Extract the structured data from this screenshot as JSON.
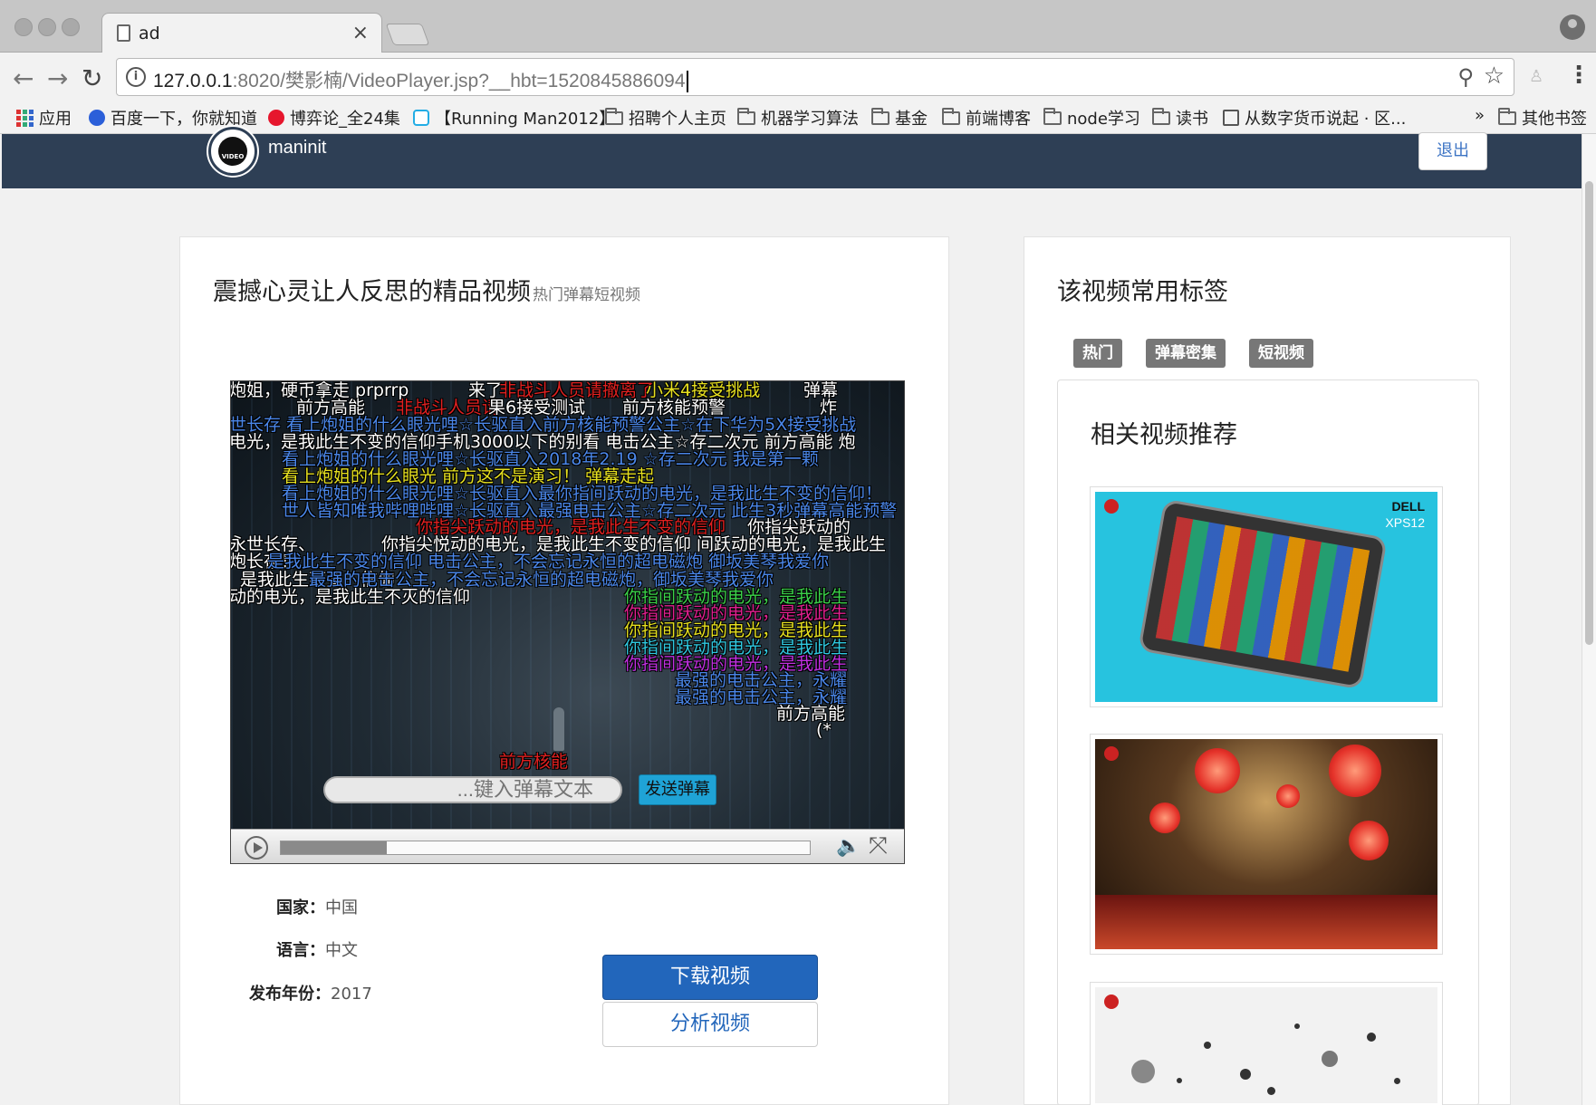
{
  "browser": {
    "tab_title": "ad",
    "tab_close": "×",
    "url_host": "127.0.0.1",
    "url_rest": ":8020/樊影楠/VideoPlayer.jsp?__hbt=1520845886094",
    "bookmarks": [
      {
        "label": "应用",
        "icon": "apps-grid-icon"
      },
      {
        "label": "百度一下，你就知道",
        "icon": "baidu-paw-icon"
      },
      {
        "label": "博弈论_全24集",
        "icon": "weibo-icon"
      },
      {
        "label": "【Running Man2012】",
        "icon": "bilibili-tv-icon"
      },
      {
        "label": "招聘个人主页",
        "icon": "folder-icon"
      },
      {
        "label": "机器学习算法",
        "icon": "folder-icon"
      },
      {
        "label": "基金",
        "icon": "folder-icon"
      },
      {
        "label": "前端博客",
        "icon": "folder-icon"
      },
      {
        "label": "node学习",
        "icon": "folder-icon"
      },
      {
        "label": "读书",
        "icon": "folder-icon"
      },
      {
        "label": "从数字货币说起 · 区...",
        "icon": "book-icon"
      }
    ],
    "bookmarks_overflow": "»",
    "other_bookmarks": "其他书签"
  },
  "site": {
    "logo_text": "VIDEO",
    "username": "maninit",
    "logout_label": "退出"
  },
  "video": {
    "title": "震撼心灵让人反思的精品视频",
    "subtitle": "热门弹幕短视频",
    "progress_percent": 20,
    "danmaku_placeholder": "...键入弹幕文本",
    "send_label": "发送弹幕",
    "danmaku": [
      {
        "text": "炮姐，硬币拿走 prprrp",
        "color": "#ffffff"
      },
      {
        "text": "来了",
        "color": "#ffffff"
      },
      {
        "text": "非战斗人员请撤离了",
        "color": "#e02020"
      },
      {
        "text": "小米4接受挑战",
        "color": "#e6e020"
      },
      {
        "text": "弹幕",
        "color": "#ffffff"
      },
      {
        "text": "前方高能",
        "color": "#ffffff"
      },
      {
        "text": "非战斗人员请",
        "color": "#e02020"
      },
      {
        "text": "果6接受测试",
        "color": "#ffffff"
      },
      {
        "text": "前方核能预警",
        "color": "#ffffff"
      },
      {
        "text": "炸",
        "color": "#ffffff"
      },
      {
        "text": "世长存  看上炮姐的什么眼光哩☆长驱直入前方核能预警公主☆在下华为5X接受挑战",
        "color": "#4a86e8"
      },
      {
        "text": "电光，是我此生不变的信仰手机3000以下的别看  电击公主☆存二次元  前方高能  炮",
        "color": "#ffffff"
      },
      {
        "text": "看上炮姐的什么眼光哩☆长驱直入2018年2.19  ☆存二次元 我是第一颗",
        "color": "#4a86e8"
      },
      {
        "text": "看上炮姐的什么眼光  前方这不是演习！  弹幕走起",
        "color": "#e6e020"
      },
      {
        "text": "看上炮姐的什么眼光哩☆长驱直入最你指间跃动的电光，是我此生不变的信仰！",
        "color": "#4a86e8"
      },
      {
        "text": "世人皆知唯我哔哩哔哩☆长驱直入最强电击公主☆存二次元  此生3秒弹幕高能预警",
        "color": "#4a86e8"
      },
      {
        "text": "你指尖跃动的电光，是我此生不变的信仰",
        "color": "#e02020"
      },
      {
        "text": "你指尖跃动的",
        "color": "#ffffff"
      },
      {
        "text": "永世长存、",
        "color": "#ffffff"
      },
      {
        "text": "你指尖悦动的电光，是我此生不变的信仰  间跃动的电光，是我此生",
        "color": "#ffffff"
      },
      {
        "text": "炮长存！",
        "color": "#ffffff"
      },
      {
        "text": "是我此生不变的信仰  电击公主，不会忘记永恒的超电磁炮  御坂美琴我爱你",
        "color": "#4a86e8"
      },
      {
        "text": "是我此生不变的信仰",
        "color": "#ffffff"
      },
      {
        "text": "最强的电击公主，不会忘记永恒的超电磁炮，御坂美琴我爱你",
        "color": "#4a86e8"
      },
      {
        "text": "动的电光，是我此生不灭的信仰",
        "color": "#ffffff"
      },
      {
        "text": "你指间跃动的电光，是我此生",
        "color": "#3bd14a"
      },
      {
        "text": "你指间跃动的电光，是我此生",
        "color": "#e02090"
      },
      {
        "text": "你指间跃动的电光，是我此生",
        "color": "#e6e020"
      },
      {
        "text": "你指间跃动的电光，是我此生",
        "color": "#30c8e0"
      },
      {
        "text": "你指间跃动的电光，是我此生",
        "color": "#c030e0"
      },
      {
        "text": "最强的电击公主，永耀",
        "color": "#4a86e8"
      },
      {
        "text": "最强的电击公主，永耀",
        "color": "#4a86e8"
      },
      {
        "text": "前方高能",
        "color": "#ffffff"
      },
      {
        "text": "(*",
        "color": "#ffffff"
      },
      {
        "text": "前方核能",
        "color": "#e02020"
      }
    ]
  },
  "meta": {
    "country_label": "国家：",
    "country_value": "中国",
    "language_label": "语言：",
    "language_value": "中文",
    "year_label": "发布年份：",
    "year_value": "2017"
  },
  "actions": {
    "download_label": "下载视频",
    "analyze_label": "分析视频"
  },
  "sidebar": {
    "tags_title": "该视频常用标签",
    "tags": [
      "热门",
      "弹幕密集",
      "短视频"
    ],
    "recommend_title": "相关视频推荐",
    "thumbs": [
      {
        "brand": "DELL",
        "model": "XPS12"
      },
      {
        "brand": "",
        "model": ""
      },
      {
        "brand": "",
        "model": ""
      }
    ]
  }
}
